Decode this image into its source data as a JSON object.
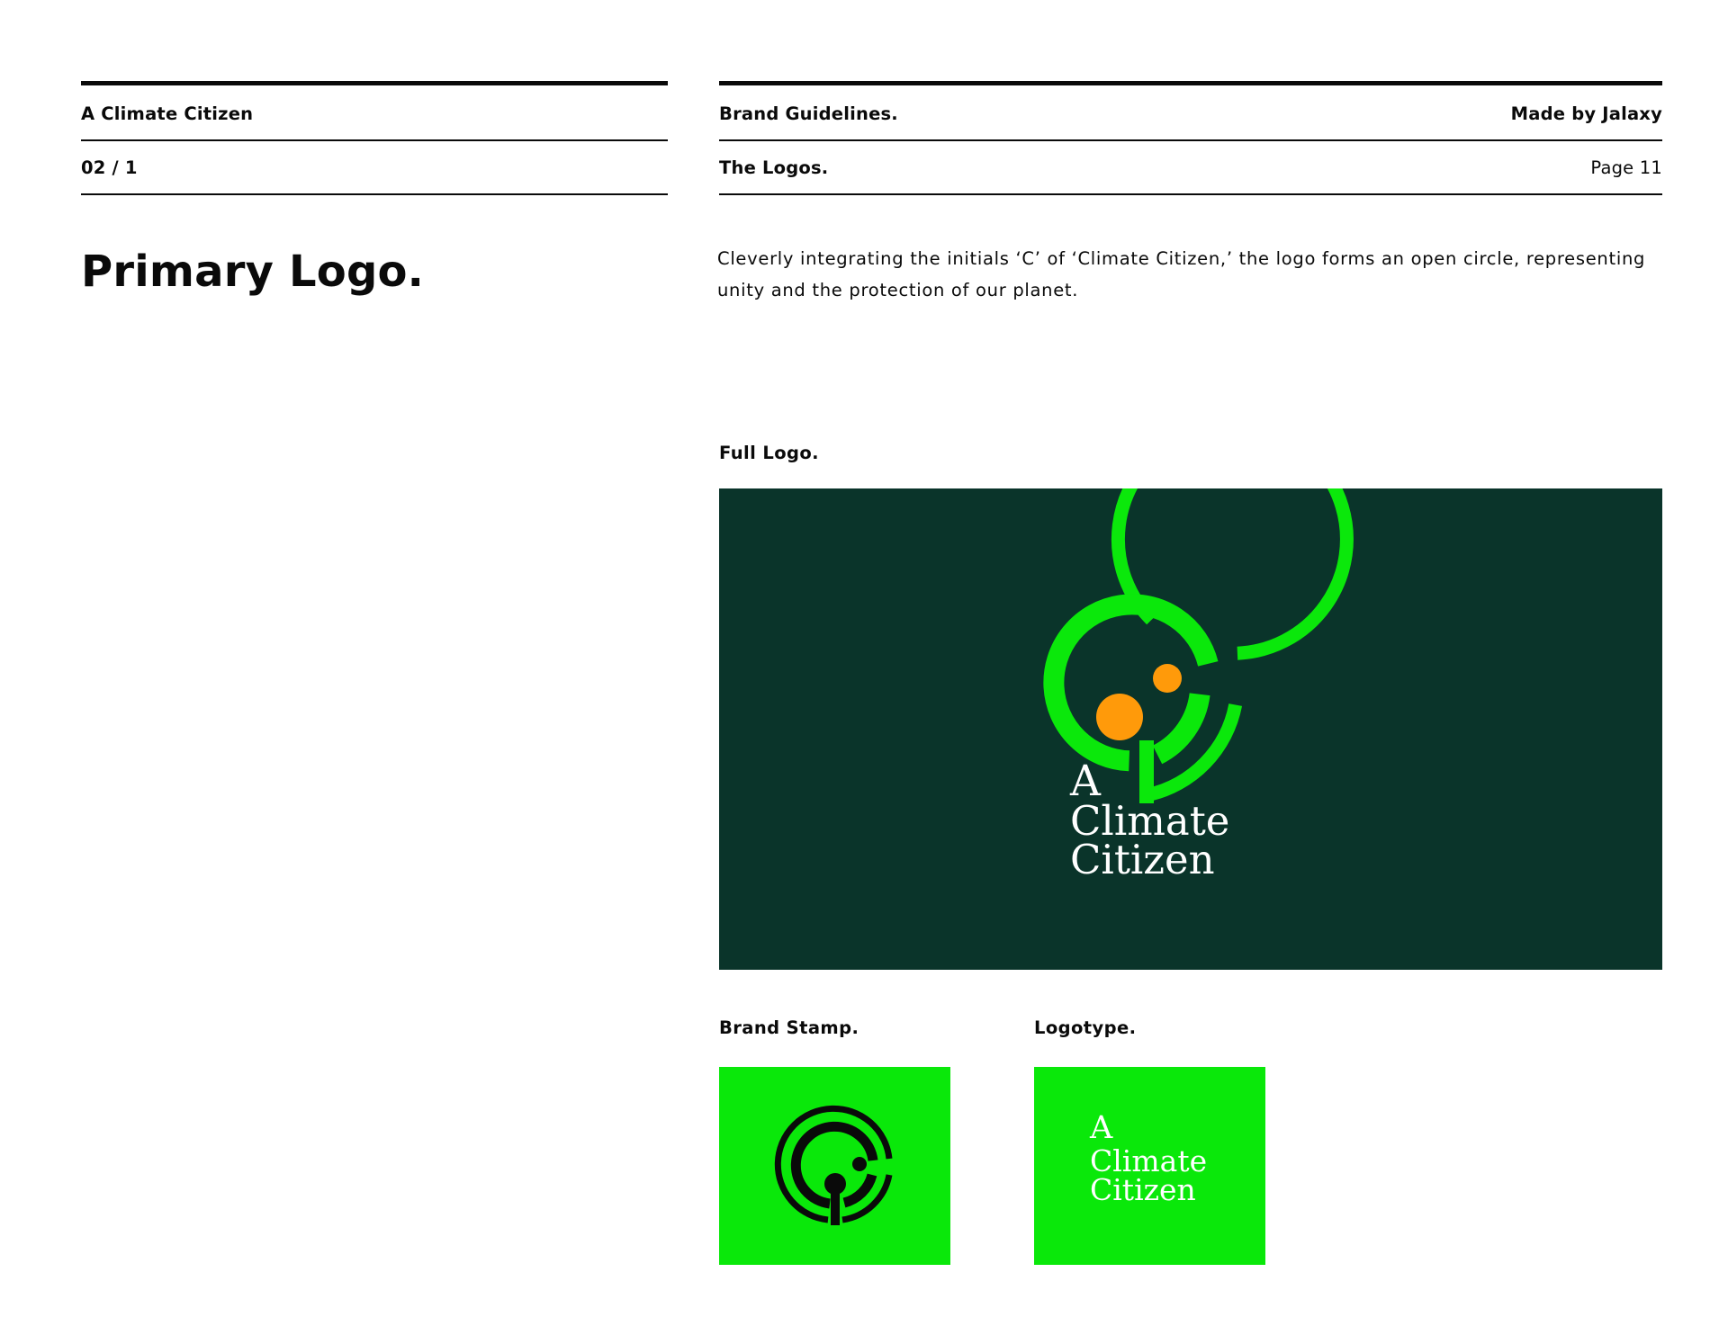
{
  "header": {
    "brand_name": "A Climate Citizen",
    "section_number": "02 / 1",
    "doc_title": "Brand Guidelines.",
    "credit": "Made by Jalaxy",
    "chapter": "The Logos.",
    "page": "Page 11"
  },
  "main": {
    "title": "Primary Logo.",
    "description": "Cleverly integrating the initials ‘C’ of ‘Climate Citizen,’ the logo forms an open circle, representing unity and the protection of our planet."
  },
  "full_logo": {
    "label": "Full Logo.",
    "wordmark": {
      "line1": "A",
      "line2": "Climate",
      "line3": "Citizen"
    },
    "colors": {
      "background": "#0a342a",
      "mark": "#0be80b",
      "accent": "#ff9a0a",
      "text": "#ffffff"
    }
  },
  "brand_stamp": {
    "label": "Brand Stamp.",
    "colors": {
      "background": "#0ae80a",
      "mark": "#0a0a0a"
    }
  },
  "logotype": {
    "label": "Logotype.",
    "wordmark": {
      "line1": "A",
      "line2": "Climate",
      "line3": "Citizen"
    },
    "colors": {
      "background": "#0ae80a",
      "text": "#ffffff"
    }
  }
}
